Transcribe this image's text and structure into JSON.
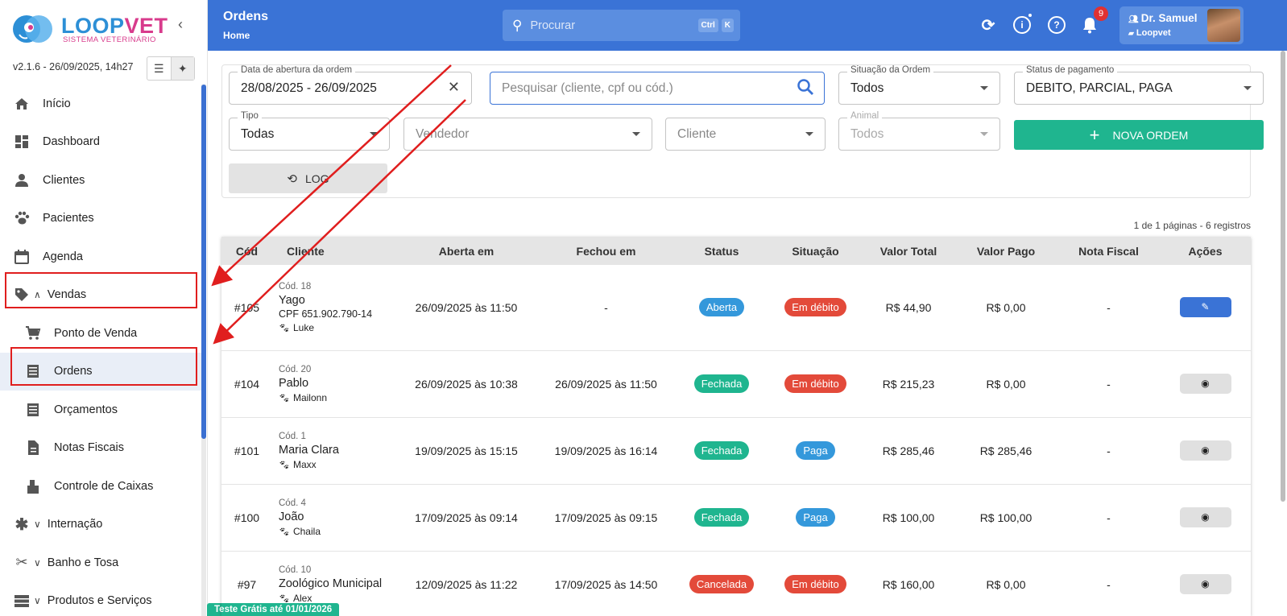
{
  "brand": {
    "name_a": "LOOP",
    "name_b": "VET",
    "subtitle": "SISTEMA VETERINÁRIO",
    "version": "v2.1.6 - 26/09/2025, 14h27"
  },
  "sidebar": {
    "items": [
      {
        "label": "Início",
        "icon": "home-icon"
      },
      {
        "label": "Dashboard",
        "icon": "dashboard-icon"
      },
      {
        "label": "Clientes",
        "icon": "person-icon"
      },
      {
        "label": "Pacientes",
        "icon": "paw-icon"
      },
      {
        "label": "Agenda",
        "icon": "calendar-icon"
      },
      {
        "label": "Vendas",
        "icon": "tag-icon"
      },
      {
        "label": "Ponto de Venda",
        "icon": "cart-icon"
      },
      {
        "label": "Ordens",
        "icon": "list-icon"
      },
      {
        "label": "Orçamentos",
        "icon": "list-icon"
      },
      {
        "label": "Notas Fiscais",
        "icon": "document-icon"
      },
      {
        "label": "Controle de Caixas",
        "icon": "cash-register-icon"
      },
      {
        "label": "Internação",
        "icon": "asterisk-icon"
      },
      {
        "label": "Banho e Tosa",
        "icon": "scissors-icon"
      },
      {
        "label": "Produtos e Serviços",
        "icon": "storage-icon"
      }
    ],
    "trial": "Teste Grátis até 01/01/2026"
  },
  "topbar": {
    "title": "Ordens",
    "breadcrumb": "Home",
    "search_placeholder": "Procurar",
    "kbd_ctrl": "Ctrl",
    "kbd_k": "K",
    "notif_count": "9",
    "user_name": "Dr. Samuel",
    "user_clinic": "Loopvet"
  },
  "filters": {
    "date_label": "Data de abertura da ordem",
    "date_value": "28/08/2025 - 26/09/2025",
    "search_placeholder": "Pesquisar (cliente, cpf ou cód.)",
    "situacao_label": "Situação da Ordem",
    "situacao_value": "Todos",
    "pagamento_label": "Status de pagamento",
    "pagamento_value": "DEBITO, PARCIAL, PAGA",
    "tipo_label": "Tipo",
    "tipo_value": "Todas",
    "vendedor_placeholder": "Vendedor",
    "cliente_placeholder": "Cliente",
    "animal_label": "Animal",
    "animal_value": "Todos",
    "new_order": "NOVA ORDEM",
    "log": "LOG"
  },
  "pager": "1 de 1 páginas - 6 registros",
  "table": {
    "headers": [
      "Cód",
      "Cliente",
      "Aberta em",
      "Fechou em",
      "Status",
      "Situação",
      "Valor Total",
      "Valor Pago",
      "Nota Fiscal",
      "Ações"
    ],
    "rows": [
      {
        "cod": "#105",
        "client_code": "Cód. 18",
        "client": "Yago",
        "cpf": "CPF 651.902.790-14",
        "pet": "Luke",
        "opened": "26/09/2025 às 11:50",
        "closed": "-",
        "status": "Aberta",
        "situacao": "Em débito",
        "total": "R$ 44,90",
        "paid": "R$ 0,00",
        "nf": "-",
        "action": "edit"
      },
      {
        "cod": "#104",
        "client_code": "Cód. 20",
        "client": "Pablo",
        "cpf": "",
        "pet": "Mailonn",
        "opened": "26/09/2025 às 10:38",
        "closed": "26/09/2025 às 11:50",
        "status": "Fechada",
        "situacao": "Em débito",
        "total": "R$ 215,23",
        "paid": "R$ 0,00",
        "nf": "-",
        "action": "view"
      },
      {
        "cod": "#101",
        "client_code": "Cód. 1",
        "client": "Maria Clara",
        "cpf": "",
        "pet": "Maxx",
        "opened": "19/09/2025 às 15:15",
        "closed": "19/09/2025 às 16:14",
        "status": "Fechada",
        "situacao": "Paga",
        "total": "R$ 285,46",
        "paid": "R$ 285,46",
        "nf": "-",
        "action": "view"
      },
      {
        "cod": "#100",
        "client_code": "Cód. 4",
        "client": "João",
        "cpf": "",
        "pet": "Chaila",
        "opened": "17/09/2025 às 09:14",
        "closed": "17/09/2025 às 09:15",
        "status": "Fechada",
        "situacao": "Paga",
        "total": "R$ 100,00",
        "paid": "R$ 100,00",
        "nf": "-",
        "action": "view"
      },
      {
        "cod": "#97",
        "client_code": "Cód. 10",
        "client": "Zoológico Municipal",
        "cpf": "",
        "pet": "Alex",
        "opened": "12/09/2025 às 11:22",
        "closed": "17/09/2025 às 14:50",
        "status": "Cancelada",
        "situacao": "Em débito",
        "total": "R$ 160,00",
        "paid": "R$ 0,00",
        "nf": "-",
        "action": "view"
      }
    ]
  },
  "colors": {
    "primary": "#3a73d6",
    "accent_green": "#1fb58f",
    "status_blue": "#3498db",
    "status_red": "#e34a3a",
    "annotation_red": "#e01e1e"
  }
}
